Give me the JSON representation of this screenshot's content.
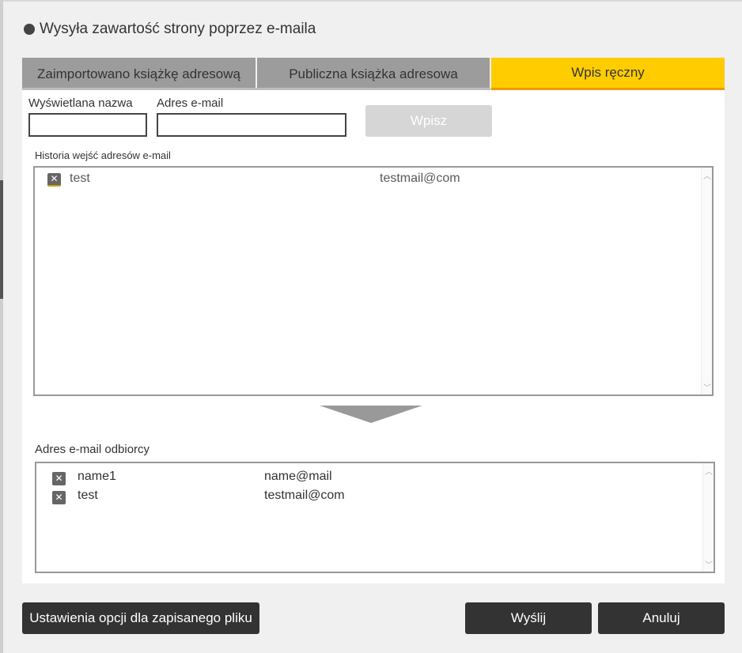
{
  "title": "Wysyła zawartość strony poprzez e-maila",
  "tabs": [
    {
      "label": "Zaimportowano książkę adresową"
    },
    {
      "label": "Publiczna książka adresowa"
    },
    {
      "label": "Wpis ręczny"
    }
  ],
  "form": {
    "display_name_label": "Wyświetlana nazwa",
    "display_name_value": "",
    "email_label": "Adres e-mail",
    "email_value": "",
    "enter_button": "Wpisz"
  },
  "history": {
    "label": "Historia wejść adresów e-mail",
    "items": [
      {
        "name": "test",
        "email": "testmail@com"
      }
    ]
  },
  "recipients": {
    "label": "Adres e-mail odbiorcy",
    "items": [
      {
        "name": "name1",
        "email": "name@mail"
      },
      {
        "name": "test",
        "email": "testmail@com"
      }
    ]
  },
  "footer": {
    "options_button": "Ustawienia opcji dla zapisanego pliku",
    "send_button": "Wyślij",
    "cancel_button": "Anuluj"
  },
  "colors": {
    "active_tab": "#ffcc00",
    "active_tab_underline": "#f39800",
    "inactive_tab": "#9c9c9c",
    "dark_button": "#333333"
  }
}
